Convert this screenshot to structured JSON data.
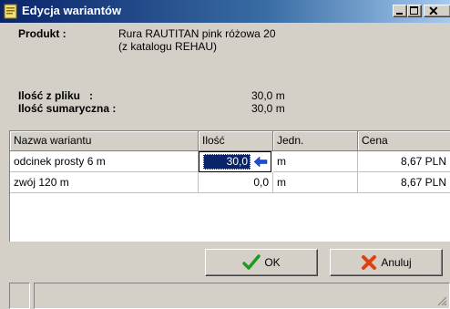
{
  "window": {
    "title": "Edycja wariantów"
  },
  "product": {
    "label": "Produkt :",
    "name": "Rura RAUTITAN pink różowa 20",
    "catalog": "(z katalogu REHAU)"
  },
  "quantities": {
    "from_file_label": "Ilość z pliku   :",
    "from_file_value": "30,0 m",
    "total_label": "Ilość sumaryczna :",
    "total_value": "30,0 m"
  },
  "table": {
    "columns": [
      "Nazwa wariantu",
      "Ilość",
      "Jedn.",
      "Cena"
    ],
    "rows": [
      {
        "name": "odcinek prosty 6 m",
        "qty": "30,0",
        "unit": "m",
        "price": "8,67  PLN"
      },
      {
        "name": "zwój 120 m",
        "qty": "0,0",
        "unit": "m",
        "price": "8,67  PLN"
      }
    ]
  },
  "buttons": {
    "ok": "OK",
    "cancel": "Anuluj"
  },
  "colors": {
    "title_start": "#0a246a",
    "title_end": "#a6caf0",
    "ok_check": "#1f9a1f",
    "cancel_x": "#e04010"
  },
  "icons": {
    "title": "document-icon",
    "arrow": "arrow-left-icon"
  }
}
